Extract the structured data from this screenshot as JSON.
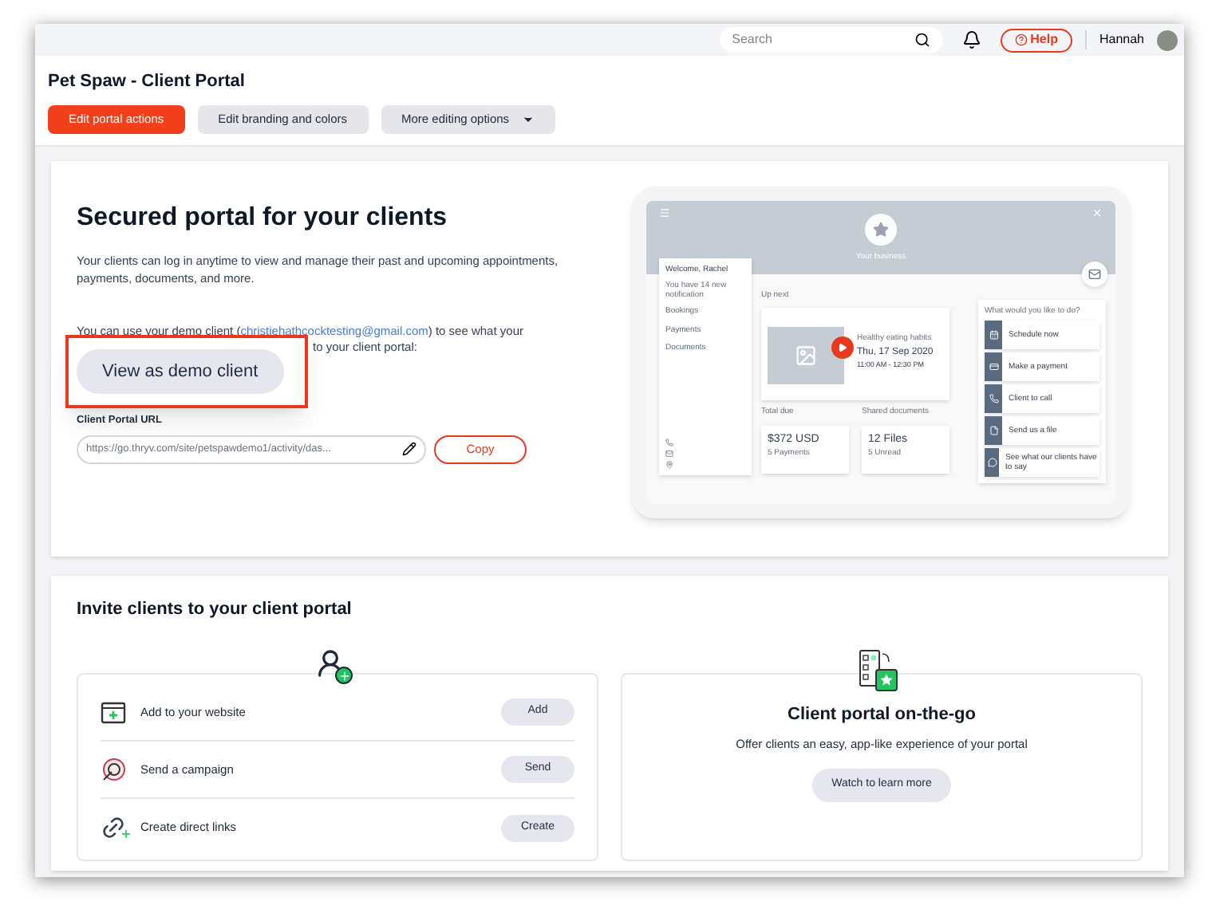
{
  "topbar": {
    "search": {
      "placeholder": "Search"
    },
    "help": "Help",
    "user": "Hannah"
  },
  "header": {
    "title": "Pet Spaw - Client Portal",
    "actions": [
      {
        "label": "Edit portal actions",
        "selected": true,
        "dropdown": false
      },
      {
        "label": "Edit branding and colors",
        "selected": false,
        "dropdown": false
      },
      {
        "label": "More editing options",
        "selected": false,
        "dropdown": true
      }
    ]
  },
  "portal": {
    "title": "Secured portal for your clients",
    "description": "Your clients can log in anytime to view and manage their past and upcoming appointments, payments, documents, and more.",
    "demo_before": "You can use your demo client (",
    "demo_email": "christiehathcocktesting@gmail.com",
    "demo_after": ") to see what your",
    "demo_line2": "to your client portal:",
    "demo_button": "View as demo client",
    "url_label": "Client Portal URL",
    "url_value": "https://go.thryv.com/site/petspawdemo1/activity/das...",
    "copy": "Copy",
    "preview": {
      "business": "Your business",
      "welcome": "Welcome, Rachel",
      "notice": "You have 14 new notification",
      "links": [
        "Bookings",
        "Payments",
        "Documents"
      ],
      "up_next": "Up next",
      "event": "Healthy eating habits",
      "date": "Thu, 17 Sep 2020",
      "time": "11:00 AM - 12:30 PM",
      "total_label": "Total due",
      "total": "$372",
      "currency": "USD",
      "payments": "5 Payments",
      "docs_label": "Shared documents",
      "files": "12",
      "files_unit": "Files",
      "unread": "5 Unread",
      "actions_title": "What would you like to do?",
      "actions": [
        "Schedule now",
        "Make a payment",
        "Client to call",
        "Send us a file",
        "See what our clients have to say"
      ]
    }
  },
  "invite": {
    "title": "Invite clients to your client portal",
    "rows": [
      {
        "kind": "website",
        "label": "Add to your website",
        "button": "Add"
      },
      {
        "kind": "campaign",
        "label": "Send a campaign",
        "button": "Send"
      },
      {
        "kind": "link",
        "label": "Create direct links",
        "button": "Create"
      }
    ],
    "mobile": {
      "title": "Client portal on-the-go",
      "text": "Offer clients an easy, app-like experience of your portal",
      "button": "Watch to learn more"
    }
  }
}
